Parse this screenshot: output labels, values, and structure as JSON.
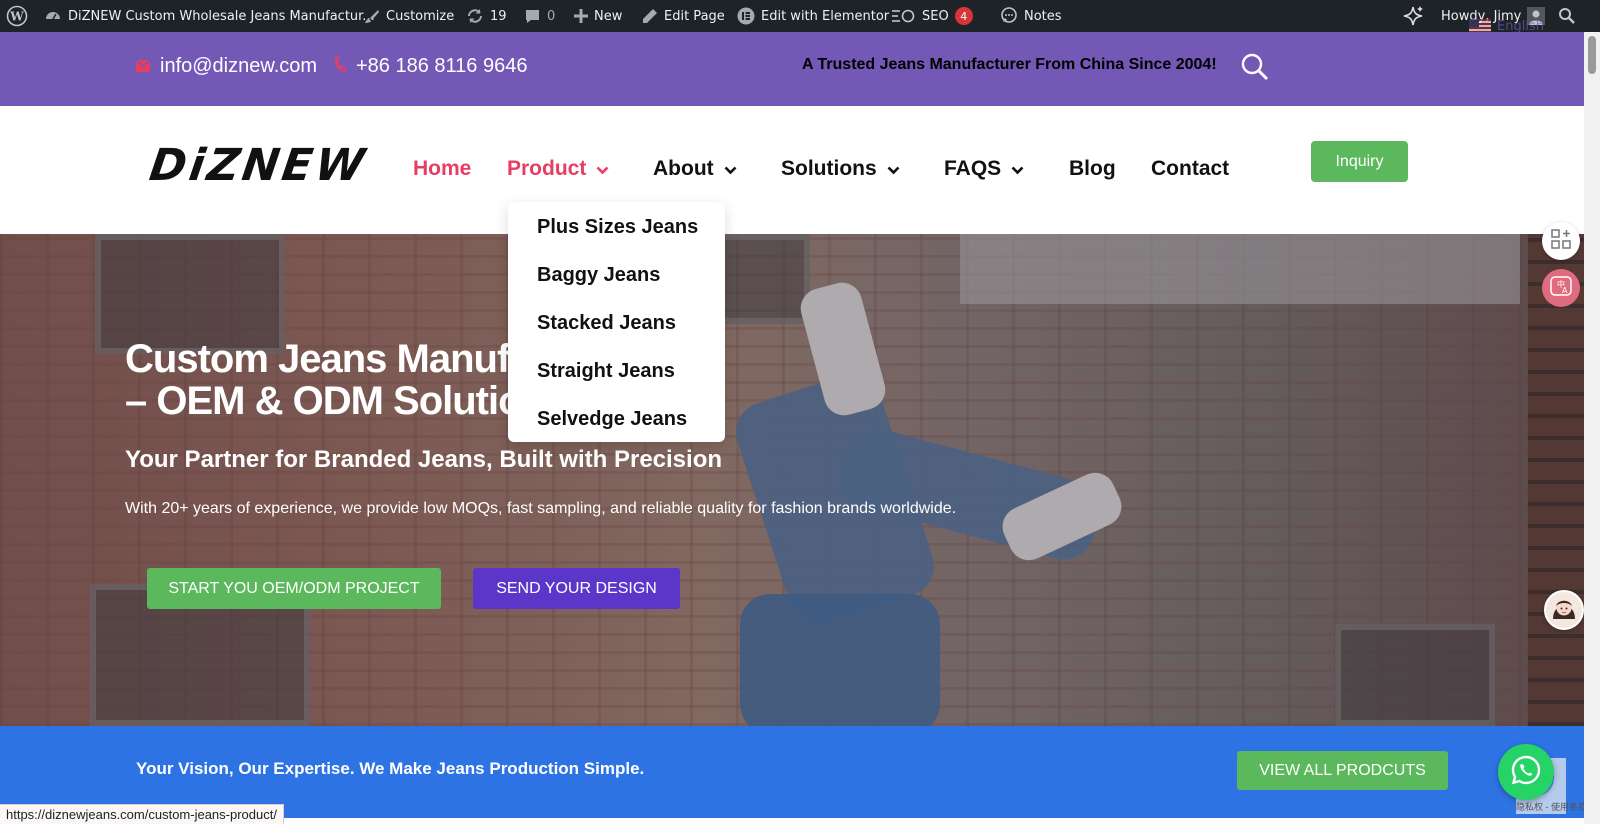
{
  "admin_bar": {
    "site_name": "DiZNEW Custom Wholesale Jeans Manufactur...",
    "customize": "Customize",
    "updates_count": "19",
    "comments_count": "0",
    "new_label": "New",
    "edit_page": "Edit Page",
    "edit_elementor": "Edit with Elementor",
    "seo_label": "SEO",
    "seo_badge": "4",
    "notes": "Notes",
    "howdy": "Howdy, Jimy",
    "language": "English"
  },
  "topbar": {
    "email": "info@diznew.com",
    "phone": "+86 186 8116 9646",
    "tagline": "A Trusted Jeans Manufacturer From China Since 2004!"
  },
  "header": {
    "logo_text": "DiZNEW",
    "nav": [
      {
        "label": "Home"
      },
      {
        "label": "Product"
      },
      {
        "label": "About"
      },
      {
        "label": "Solutions"
      },
      {
        "label": "FAQS"
      },
      {
        "label": "Blog"
      },
      {
        "label": "Contact"
      }
    ],
    "inquiry": "Inquiry"
  },
  "product_menu": [
    "Plus Sizes Jeans",
    "Baggy Jeans",
    "Stacked Jeans",
    "Straight Jeans",
    "Selvedge Jeans"
  ],
  "hero": {
    "title_line1": "Custom Jeans Manuf",
    "title_line2": "– OEM & ODM Solutio",
    "subtitle": "Your Partner for Branded Jeans, Built with Precision",
    "description": "With 20+ years of experience, we provide low MOQs, fast sampling, and reliable quality for fashion brands worldwide.",
    "btn_primary": "START YOU OEM/ODM PROJECT",
    "btn_secondary": "SEND YOUR DESIGN"
  },
  "band": {
    "text": "Your Vision, Our Expertise. We Make Jeans Production Simple.",
    "button": "VIEW ALL PRODCUTS"
  },
  "recaptcha_text": "隐私权 - 使用条款",
  "status_url": "https://diznewjeans.com/custom-jeans-product/",
  "colors": {
    "admin_bar": "#1d2327",
    "topbar": "#7358b6",
    "accent_pink": "#e83d63",
    "green": "#5cb85c",
    "purple_button": "#5b36c9",
    "blue_band": "#2e73e4",
    "whatsapp": "#25d366"
  }
}
